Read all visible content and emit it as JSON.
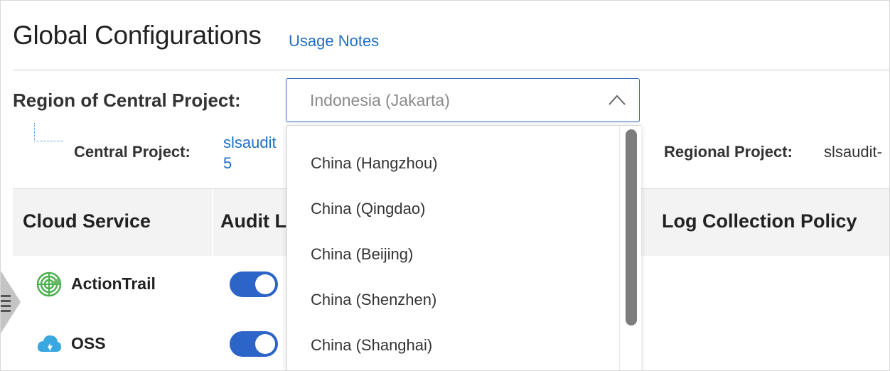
{
  "header": {
    "title": "Global Configurations",
    "usage_link": "Usage Notes"
  },
  "region": {
    "label": "Region of Central Project:",
    "selected": "Indonesia (Jakarta)",
    "options": [
      "China (Hangzhou)",
      "China (Qingdao)",
      "China (Beijing)",
      "China (Shenzhen)",
      "China (Shanghai)"
    ]
  },
  "projects": {
    "central_label": "Central Project:",
    "central_value": "slsaudit 5",
    "regional_label": "Regional Project:",
    "regional_value": "slsaudit-"
  },
  "table": {
    "headers": [
      "Cloud Service",
      "Audit L",
      "Log Collection Policy"
    ],
    "rows": [
      {
        "name": "ActionTrail",
        "icon": "actiontrail-icon",
        "enabled": true
      },
      {
        "name": "OSS",
        "icon": "oss-cloud-icon",
        "enabled": true
      }
    ]
  },
  "colors": {
    "accent": "#2c64c8",
    "link": "#1f6fc6"
  }
}
